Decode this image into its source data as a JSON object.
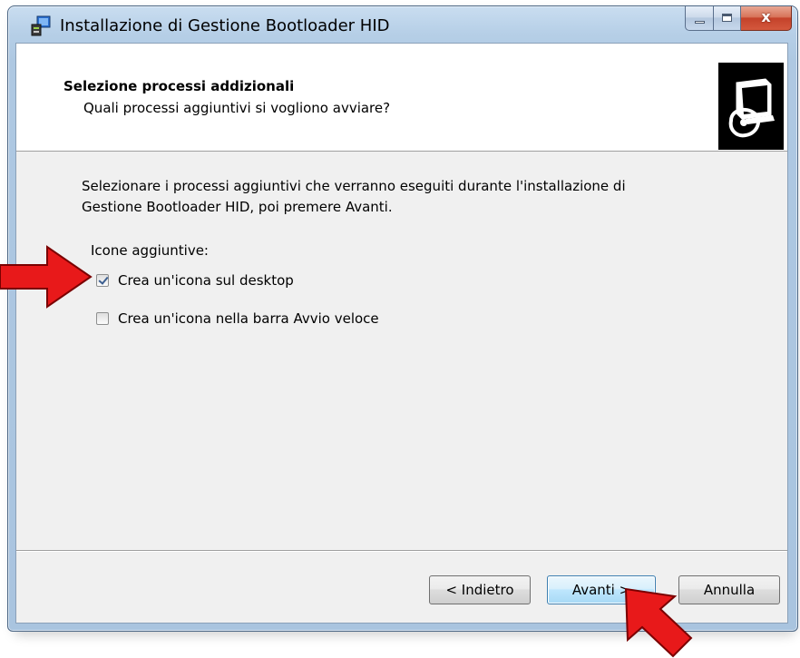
{
  "window": {
    "title": "Installazione di Gestione Bootloader HID",
    "close_glyph": "x"
  },
  "header": {
    "title": "Selezione processi addizionali",
    "subtitle": "Quali processi aggiuntivi si vogliono avviare?",
    "image_icon": "computer-disk-icon"
  },
  "body": {
    "intro_line1": "Selezionare i processi aggiuntivi che verranno eseguiti durante l'installazione di",
    "intro_line2": "Gestione Bootloader HID, poi premere Avanti.",
    "group_label": "Icone aggiuntive:",
    "options": [
      {
        "label": "Crea un'icona sul desktop",
        "checked": true
      },
      {
        "label": "Crea un'icona nella barra Avvio veloce",
        "checked": false
      }
    ]
  },
  "buttons": {
    "back": "< Indietro",
    "next": "Avanti >",
    "cancel": "Annulla"
  },
  "annotations": {
    "arrow_color": "#e8191a",
    "arrows": [
      "arrow-pointing-right",
      "arrow-pointing-up-left"
    ]
  }
}
